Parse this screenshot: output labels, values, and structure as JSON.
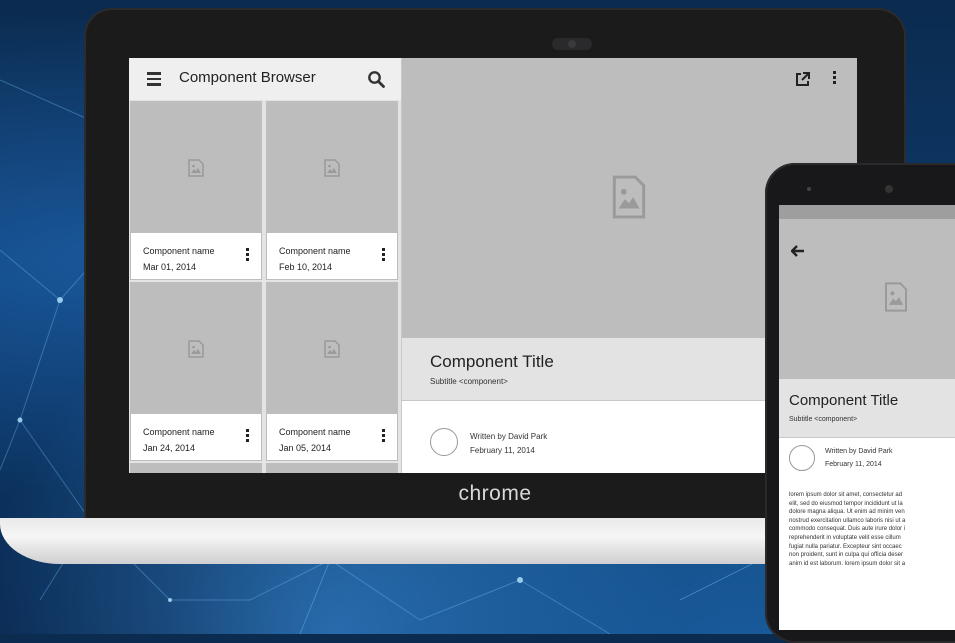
{
  "brand": {
    "device_logo": "chrome"
  },
  "app": {
    "title": "Component Browser",
    "menu_icon": "hamburger-menu-icon",
    "search_icon": "search-icon"
  },
  "cards": [
    {
      "name": "Component name",
      "date": "Mar 01, 2014"
    },
    {
      "name": "Component name",
      "date": "Feb 10, 2014"
    },
    {
      "name": "Component name",
      "date": "Jan 24, 2014"
    },
    {
      "name": "Component name",
      "date": "Jan 05, 2014"
    }
  ],
  "detail": {
    "title": "Component Title",
    "subtitle": "Subtitle <component>",
    "author": "Written by David Park",
    "date": "February 11, 2014"
  },
  "phone": {
    "title": "Component Title",
    "subtitle": "Subtitle <component>",
    "author": "Written by David Park",
    "date": "February 11, 2014",
    "body_lines": [
      "lorem ipsum dolor sit amet, consectetur ad",
      "elit, sed do eiusmod tempor incididunt ut la",
      "dolore magna aliqua. Ut enim ad minim ven",
      "nostrud exercitation ullamco laboris nisi ut a",
      "commodo consequat. Duis aute irure dolor i",
      "reprehenderit in voluptate velit esse cillum",
      "fugiat nulla pariatur. Excepteur sint occaec",
      "non proident, sunt in culpa qui officia deser",
      "anim id est laborum. lorem ipsum dolor sit a"
    ]
  },
  "colors": {
    "placeholder": "#bdbdbd",
    "appbar": "#efefef",
    "titlebar": "#e3e3e3",
    "background": "#0d3b6c"
  }
}
